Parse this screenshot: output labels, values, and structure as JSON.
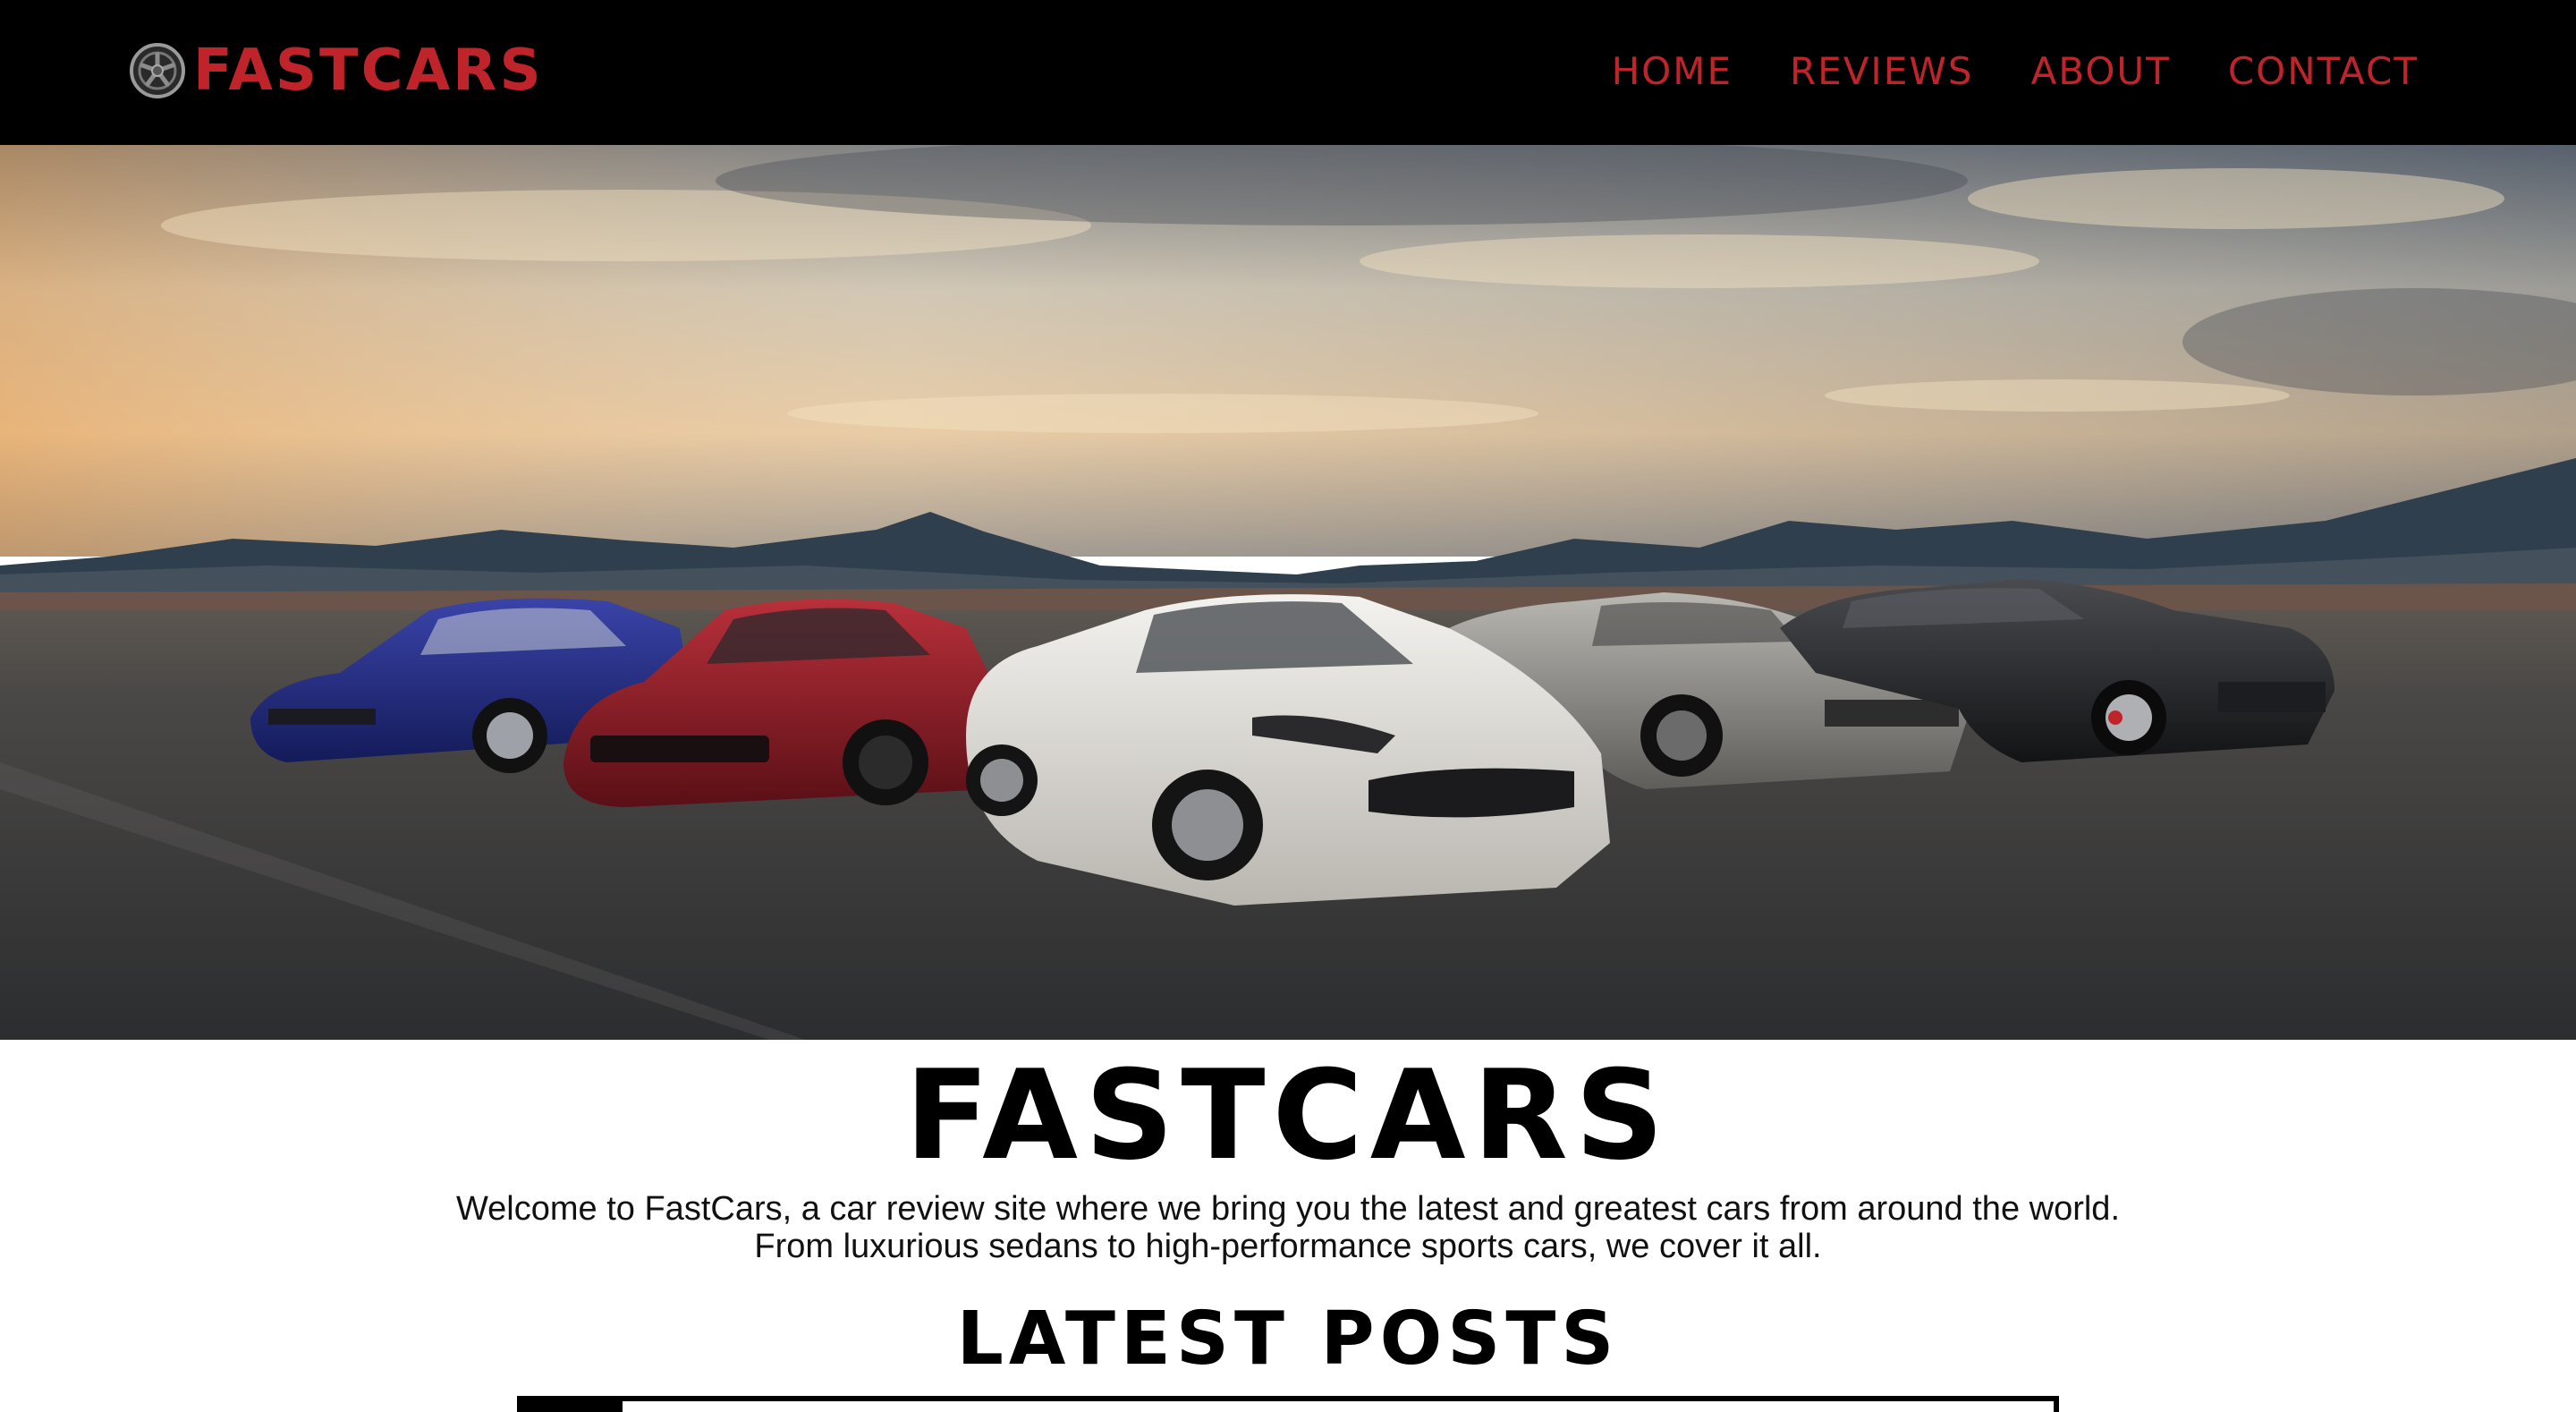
{
  "header": {
    "brand": "FASTCARS",
    "brand_icon": "wheel-icon",
    "nav": [
      {
        "label": "HOME"
      },
      {
        "label": "REVIEWS"
      },
      {
        "label": "ABOUT"
      },
      {
        "label": "CONTACT"
      }
    ]
  },
  "hero": {
    "image": "five-sports-cars-desert-sunset"
  },
  "main": {
    "title": "FASTCARS",
    "intro_line1": "Welcome to FastCars, a car review site where we bring you the latest and greatest cars from around the world.",
    "intro_line2": "From luxurious sedans to high-performance sports cars, we cover it all.",
    "latest_heading": "LATEST POSTS"
  },
  "colors": {
    "accent": "#c0242b",
    "navbar_bg": "#000000",
    "page_bg": "#ffffff"
  }
}
